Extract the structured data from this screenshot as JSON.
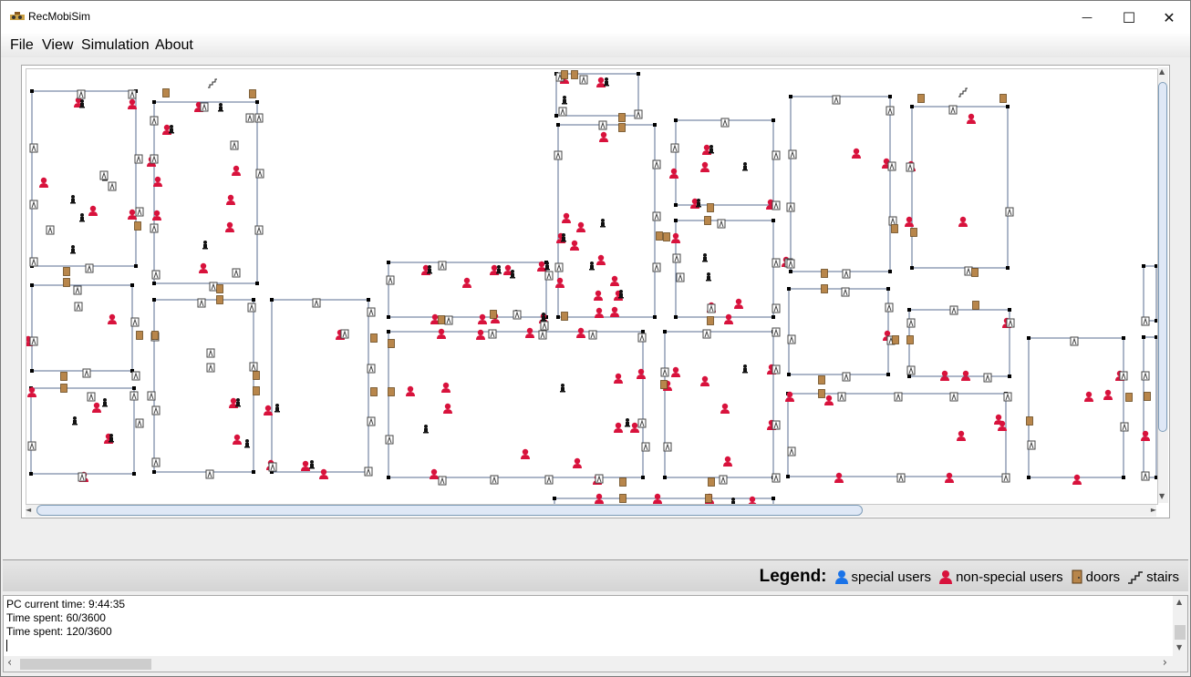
{
  "window": {
    "title": "RecMobiSim",
    "minimize_glyph": "—",
    "maximize_glyph": "☐",
    "close_glyph": "✕"
  },
  "menubar": {
    "items": [
      "File",
      "View",
      "Simulation",
      "About"
    ]
  },
  "canvas": {
    "scroll_up_glyph": "▲",
    "scroll_down_glyph": "▼",
    "scroll_left_glyph": "◄",
    "scroll_right_glyph": "►",
    "icon_names": [
      "non-special-user-icon",
      "occupant-icon",
      "door-icon",
      "passage-icon",
      "stairs-icon"
    ]
  },
  "legend": {
    "title": "Legend:",
    "special_users": "special users",
    "non_special_users": "non-special users",
    "doors": "doors",
    "stairs": "stairs",
    "colors": {
      "special": "#1a73e8",
      "non_special": "#d8123c",
      "door": "#b8864b"
    }
  },
  "log": {
    "lines": [
      "PC current time: 9:44:35",
      "Time spent: 60/3600",
      "Time spent: 120/3600"
    ],
    "scroll_up_glyph": "▲",
    "scroll_down_glyph": "▼",
    "scroll_left_glyph": "‹",
    "scroll_right_glyph": "›"
  }
}
